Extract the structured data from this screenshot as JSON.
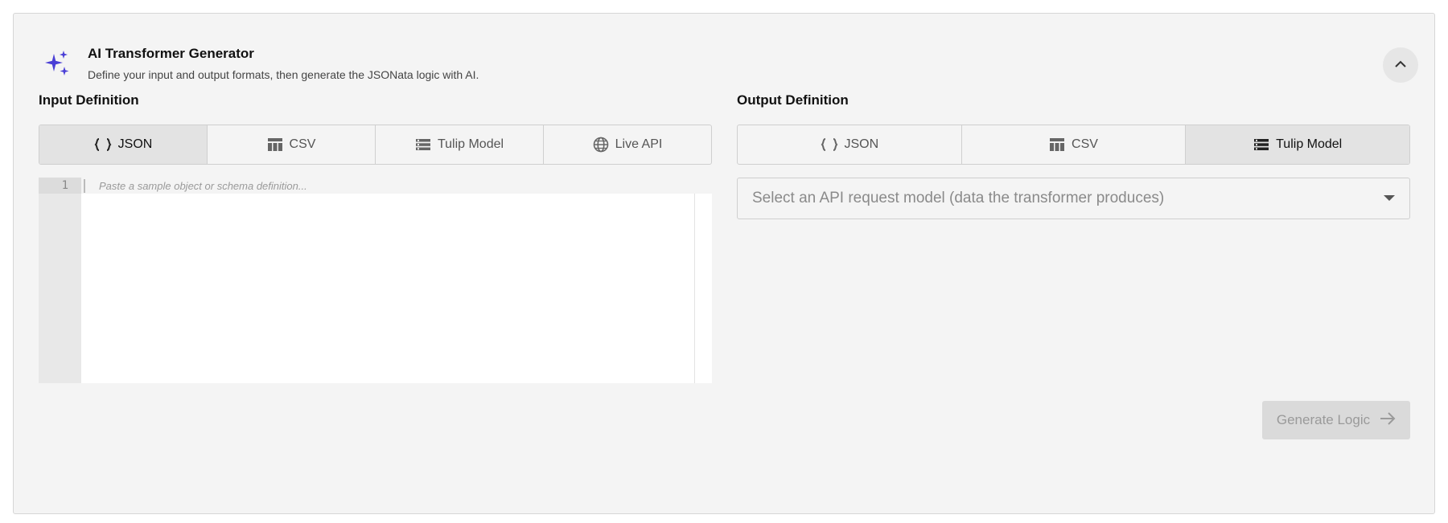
{
  "header": {
    "title": "AI Transformer Generator",
    "subtitle": "Define your input and output formats, then generate the JSONata logic with AI.",
    "icon": "sparkles-icon",
    "collapse_icon": "chevron-up-icon",
    "accent_color": "#4a3fd6"
  },
  "input": {
    "label": "Input Definition",
    "tabs": [
      {
        "label": "JSON",
        "icon": "braces-icon",
        "active": true
      },
      {
        "label": "CSV",
        "icon": "table-icon",
        "active": false
      },
      {
        "label": "Tulip Model",
        "icon": "list-icon",
        "active": false
      },
      {
        "label": "Live API",
        "icon": "globe-icon",
        "active": false
      }
    ],
    "editor": {
      "line_number": "1",
      "placeholder": "Paste a sample object or schema definition..."
    }
  },
  "output": {
    "label": "Output Definition",
    "tabs": [
      {
        "label": "JSON",
        "icon": "braces-icon",
        "active": false
      },
      {
        "label": "CSV",
        "icon": "table-icon",
        "active": false
      },
      {
        "label": "Tulip Model",
        "icon": "list-icon",
        "active": true
      }
    ],
    "select_placeholder": "Select an API request model (data the transformer produces)"
  },
  "actions": {
    "generate_label": "Generate Logic",
    "generate_icon": "arrow-right-icon"
  }
}
